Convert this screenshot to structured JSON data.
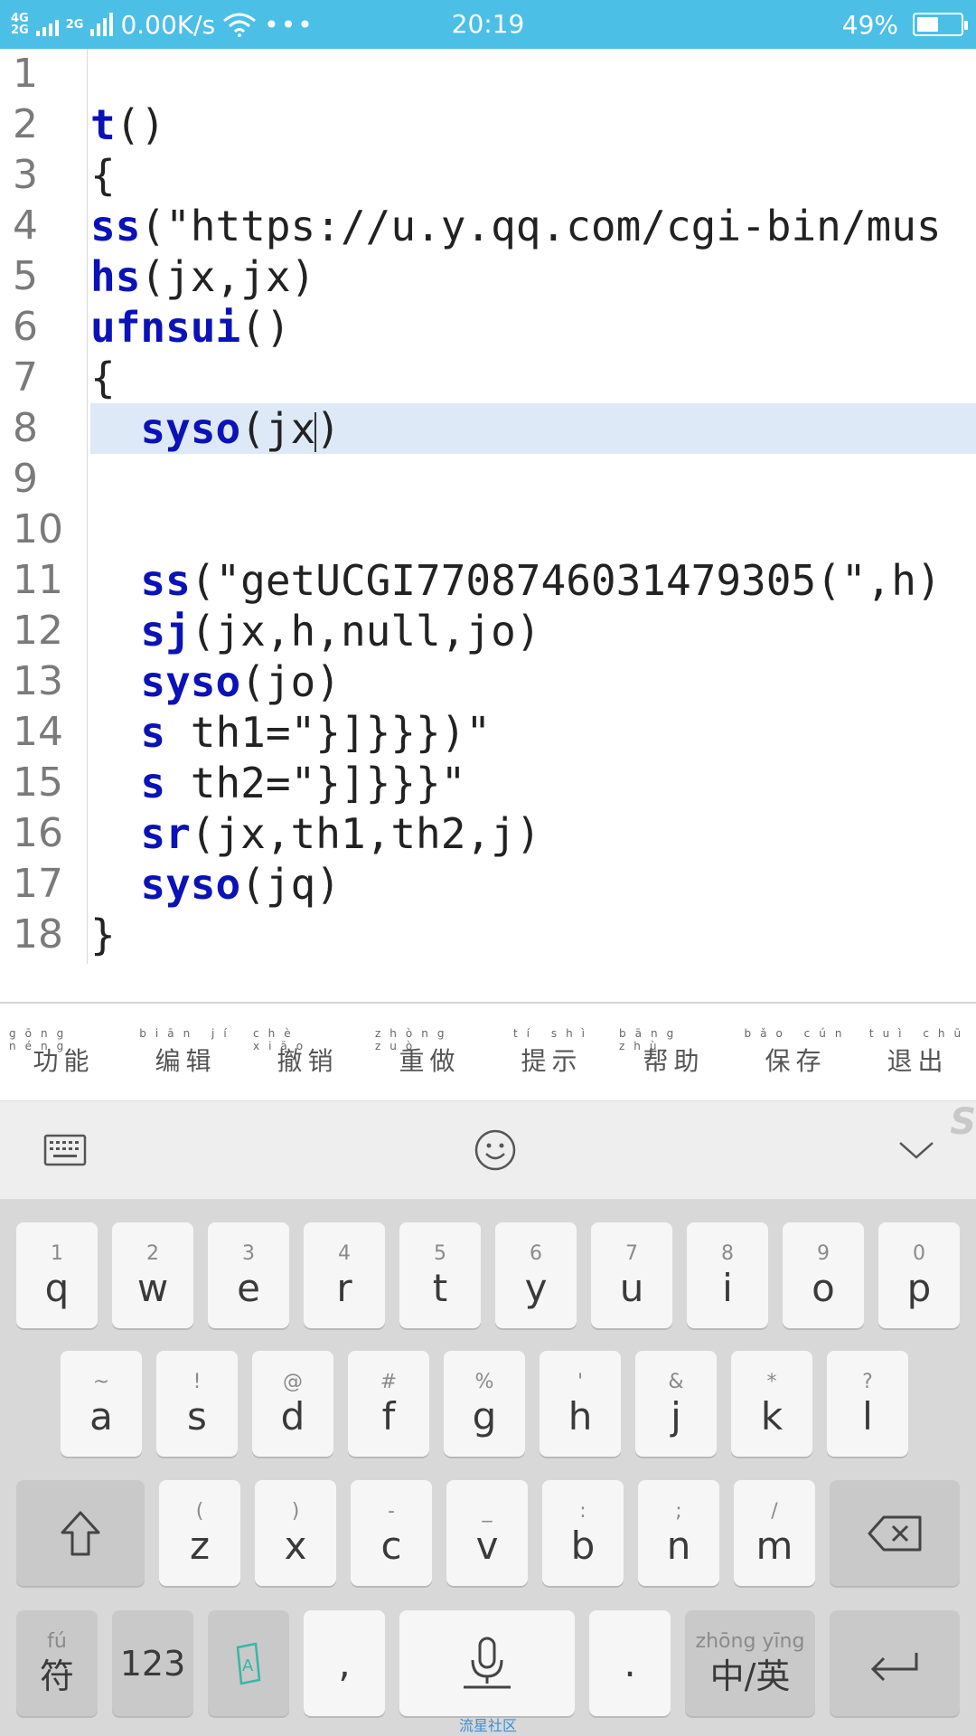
{
  "status_bar": {
    "net_badges": [
      "4G",
      "2G"
    ],
    "net_badge2": "2G",
    "speed": "0.00K/s",
    "more": "•••",
    "time": "20:19",
    "battery_text": "49%",
    "battery_level": 0.49
  },
  "editor": {
    "line_numbers": [
      "1",
      "2",
      "3",
      "4",
      "5",
      "6",
      "7",
      "8",
      "9",
      "10",
      "11",
      "12",
      "13",
      "14",
      "15",
      "16",
      "17",
      "18"
    ],
    "lines": [
      {
        "kw": "",
        "rest": ""
      },
      {
        "kw": "t",
        "rest": "()"
      },
      {
        "kw": "",
        "rest": "{"
      },
      {
        "kw": "ss",
        "rest": "(\"https://u.y.qq.com/cgi-bin/mus"
      },
      {
        "kw": "hs",
        "rest": "(jx,jx)"
      },
      {
        "kw": "ufnsui",
        "rest": "()"
      },
      {
        "kw": "",
        "rest": "{"
      },
      {
        "kw": "  syso",
        "rest_before_caret": "(jx",
        "rest_after_caret": ")"
      },
      {
        "kw": "",
        "rest": ""
      },
      {
        "kw": "",
        "rest": ""
      },
      {
        "kw": "  ss",
        "rest": "(\"getUCGI7708746031479305(\",h)"
      },
      {
        "kw": "  sj",
        "rest": "(jx,h,null,jo)"
      },
      {
        "kw": "  syso",
        "rest": "(jo)"
      },
      {
        "kw": "  s",
        "rest": " th1=\"}]}}})\""
      },
      {
        "kw": "  s",
        "rest": " th2=\"}]}}}\""
      },
      {
        "kw": "  sr",
        "rest": "(jx,th1,th2,j)"
      },
      {
        "kw": "  syso",
        "rest": "(jq)"
      },
      {
        "kw": "",
        "rest": "}"
      }
    ],
    "current_line": 8
  },
  "toolbar": [
    {
      "zh": "功能",
      "py": "gōng néng"
    },
    {
      "zh": "编辑",
      "py": "biān jí"
    },
    {
      "zh": "撤销",
      "py": "chè xiāo"
    },
    {
      "zh": "重做",
      "py": "zhòng zuò"
    },
    {
      "zh": "提示",
      "py": "tí shì"
    },
    {
      "zh": "帮助",
      "py": "bāng zhù"
    },
    {
      "zh": "保存",
      "py": "bǎo cún"
    },
    {
      "zh": "退出",
      "py": "tuì chū"
    }
  ],
  "keyboard_bar": {
    "left_icon": "keyboard-icon",
    "center_icon": "emoji-icon",
    "right_icon": "chevron-down-icon",
    "watermark": "S"
  },
  "keyboard": {
    "row1": [
      {
        "hint": "1",
        "key": "q"
      },
      {
        "hint": "2",
        "key": "w"
      },
      {
        "hint": "3",
        "key": "e"
      },
      {
        "hint": "4",
        "key": "r"
      },
      {
        "hint": "5",
        "key": "t"
      },
      {
        "hint": "6",
        "key": "y"
      },
      {
        "hint": "7",
        "key": "u"
      },
      {
        "hint": "8",
        "key": "i"
      },
      {
        "hint": "9",
        "key": "o"
      },
      {
        "hint": "0",
        "key": "p"
      }
    ],
    "row2": [
      {
        "hint": "~",
        "key": "a"
      },
      {
        "hint": "!",
        "key": "s"
      },
      {
        "hint": "@",
        "key": "d"
      },
      {
        "hint": "#",
        "key": "f"
      },
      {
        "hint": "%",
        "key": "g"
      },
      {
        "hint": "'",
        "key": "h"
      },
      {
        "hint": "&",
        "key": "j"
      },
      {
        "hint": "*",
        "key": "k"
      },
      {
        "hint": "?",
        "key": "l"
      }
    ],
    "row3": [
      {
        "hint": "(",
        "key": "z"
      },
      {
        "hint": ")",
        "key": "x"
      },
      {
        "hint": "-",
        "key": "c"
      },
      {
        "hint": "_",
        "key": "v"
      },
      {
        "hint": ":",
        "key": "b"
      },
      {
        "hint": ";",
        "key": "n"
      },
      {
        "hint": "/",
        "key": "m"
      }
    ],
    "symbols_hint": "fú",
    "symbols_label": "符",
    "numbers_label": "123",
    "comma": ",",
    "period": ".",
    "lang_hint": "zhōng     yīng",
    "lang_label": "中/英"
  },
  "footer_brand": "流星社区"
}
